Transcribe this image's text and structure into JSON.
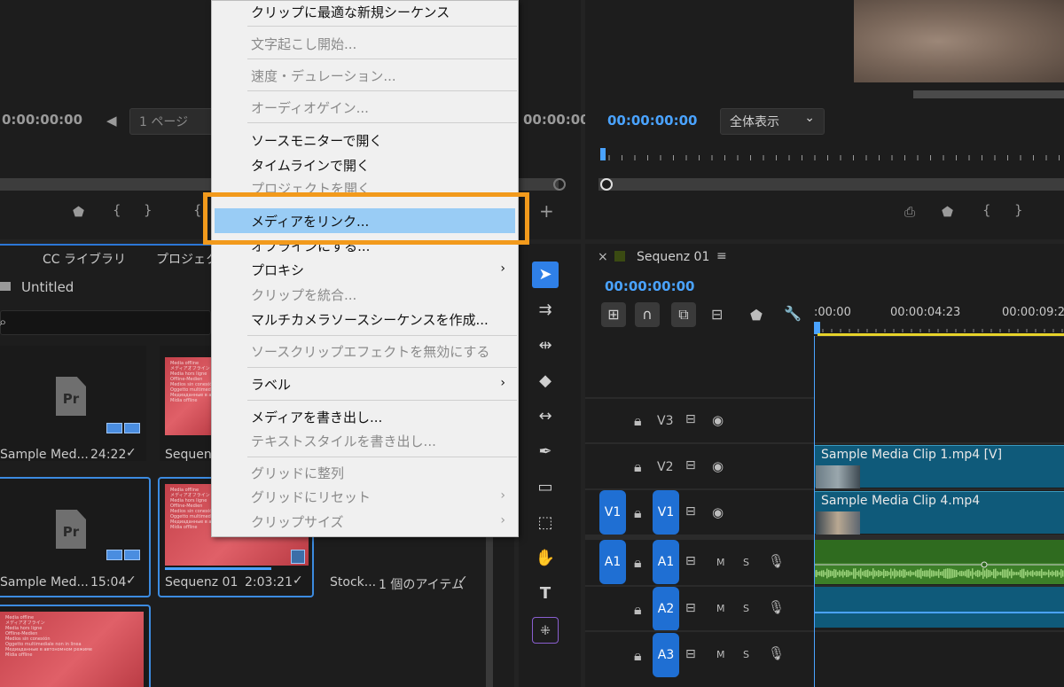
{
  "source_monitor": {
    "timecode_left": "0:00:00:00",
    "page_selector": "1 ページ",
    "timecode_right": "00:00:00"
  },
  "program_monitor": {
    "timecode": "00:00:00:00",
    "zoom_select": "全体表示"
  },
  "project_panel": {
    "tab_cc_library": "CC ライブラリ",
    "tab_project": "プロジェクト",
    "bin_name": "Untitled",
    "items": [
      {
        "name": "Sample Med...",
        "duration": "24:22"
      },
      {
        "name": "Sequenz",
        "duration": ""
      },
      {
        "name": "Sample Med...",
        "duration": "15:04"
      },
      {
        "name": "Sequenz 01",
        "duration": "2:03:21"
      },
      {
        "name": "Stock...",
        "duration": "1 個のアイテム"
      }
    ],
    "thumb_text": "Media offline\nメディアオフライン\nMedia hors ligne\nOffline-Medien\nMedios sin conexión\nOggetto multimediale non in linea\nМедиаданные в автономном режиме\nMídia offline"
  },
  "timeline": {
    "sequence_name": "Sequenz 01",
    "timecode": "00:00:00:00",
    "ruler_labels": [
      ":00:00",
      "00:00:04:23",
      "00:00:09:2"
    ],
    "tracks": {
      "v3": "V3",
      "v2": "V2",
      "v1": "V1",
      "a1": "A1",
      "a2": "A2",
      "a3": "A3",
      "src_v1": "V1",
      "src_a1": "A1",
      "mute": "M",
      "solo": "S"
    },
    "clips": {
      "clip1": "Sample Media Clip 1.mp4 [V]",
      "clip4": "Sample Media Clip 4.mp4"
    }
  },
  "context_menu": {
    "items": [
      {
        "label": "クリップに最適な新規シーケンス",
        "enabled": true
      },
      {
        "label": "文字起こし開始...",
        "enabled": false
      },
      {
        "label": "速度・デュレーション...",
        "enabled": false
      },
      {
        "label": "オーディオゲイン...",
        "enabled": false
      },
      {
        "label": "ソースモニターで開く",
        "enabled": true
      },
      {
        "label": "タイムラインで開く",
        "enabled": true
      },
      {
        "label": "プロジェクトを開く",
        "enabled": false
      },
      {
        "label": "メディアをリンク...",
        "enabled": true,
        "highlighted": true
      },
      {
        "label": "オフラインにする...",
        "enabled": true
      },
      {
        "label": "プロキシ",
        "enabled": true,
        "submenu": true
      },
      {
        "label": "クリップを統合...",
        "enabled": false
      },
      {
        "label": "マルチカメラソースシーケンスを作成...",
        "enabled": true
      },
      {
        "label": "ソースクリップエフェクトを無効にする",
        "enabled": false
      },
      {
        "label": "ラベル",
        "enabled": true,
        "submenu": true
      },
      {
        "label": "メディアを書き出し...",
        "enabled": true
      },
      {
        "label": "テキストスタイルを書き出し...",
        "enabled": false
      },
      {
        "label": "グリッドに整列",
        "enabled": false
      },
      {
        "label": "グリッドにリセット",
        "enabled": false,
        "submenu": true
      },
      {
        "label": "クリップサイズ",
        "enabled": false,
        "submenu": true
      }
    ]
  },
  "colors": {
    "accent_blue": "#4aa3ff",
    "highlight_box": "#f29a1c",
    "menu_highlight": "#99ccf5",
    "track_target": "#1f6fd3",
    "video_clip": "#0f5a7a",
    "audio_clip": "#2f6b1f"
  }
}
